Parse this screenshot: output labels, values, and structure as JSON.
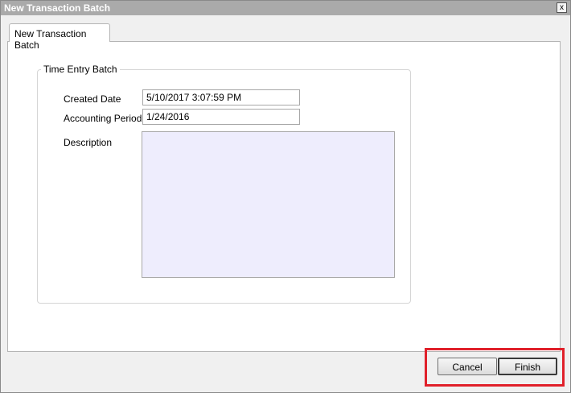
{
  "window": {
    "title": "New Transaction Batch",
    "close_label": "x"
  },
  "tab": {
    "label": "New Transaction Batch"
  },
  "group": {
    "legend": "Time Entry Batch",
    "created_date_label": "Created Date",
    "created_date_value": "5/10/2017 3:07:59 PM",
    "accounting_period_label": "Accounting Period",
    "accounting_period_value": "1/24/2016",
    "description_label": "Description",
    "description_value": ""
  },
  "buttons": {
    "cancel": "Cancel",
    "finish": "Finish"
  },
  "colors": {
    "highlight": "#e0202a",
    "description_bg": "#eeedfd",
    "titlebar": "#aaaaaa"
  }
}
